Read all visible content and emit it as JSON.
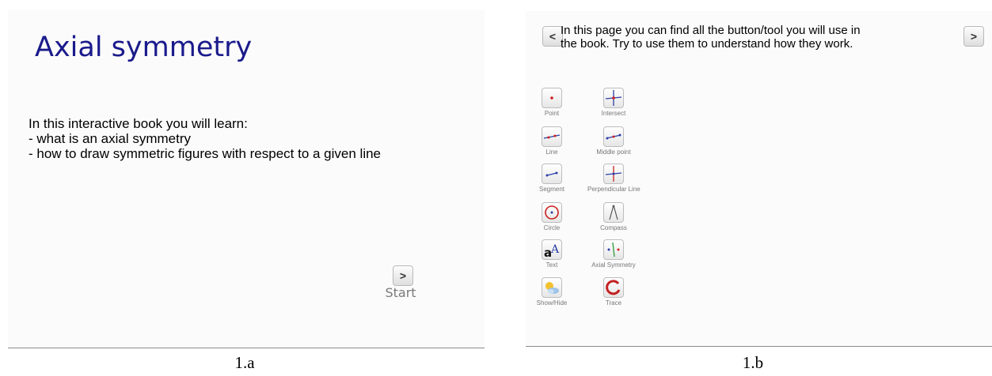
{
  "slide_a": {
    "title": "Axial symmetry",
    "intro_lines": [
      "In this interactive book you will learn:",
      "- what is an axial symmetry",
      "- how to draw symmetric figures with respect to a given line"
    ],
    "next_glyph": ">",
    "start_label": "Start",
    "caption": "1.a"
  },
  "slide_b": {
    "prev_glyph": "<",
    "next_glyph": ">",
    "description_lines": [
      "In this page you can find all the button/tool you will use in",
      "the book. Try to use them to understand how they work."
    ],
    "tools": [
      {
        "label": "Point",
        "icon": "point-icon"
      },
      {
        "label": "Intersect",
        "icon": "intersect-icon"
      },
      {
        "label": "Line",
        "icon": "line-icon"
      },
      {
        "label": "Middle point",
        "icon": "midpoint-icon"
      },
      {
        "label": "Segment",
        "icon": "segment-icon"
      },
      {
        "label": "Perpendicular Line",
        "icon": "perpendicular-line-icon"
      },
      {
        "label": "Circle",
        "icon": "circle-icon"
      },
      {
        "label": "Compass",
        "icon": "compass-icon"
      },
      {
        "label": "Text",
        "icon": "text-icon"
      },
      {
        "label": "Axial Symmetry",
        "icon": "axial-symmetry-icon"
      },
      {
        "label": "Show/Hide",
        "icon": "show-hide-icon"
      },
      {
        "label": "Trace",
        "icon": "trace-icon"
      }
    ],
    "caption": "1.b"
  },
  "colors": {
    "title": "#1a1a8c",
    "point_red": "#cc1f1f",
    "line_blue": "#2a3ea8",
    "caption_rule": "#8a8a8a"
  }
}
